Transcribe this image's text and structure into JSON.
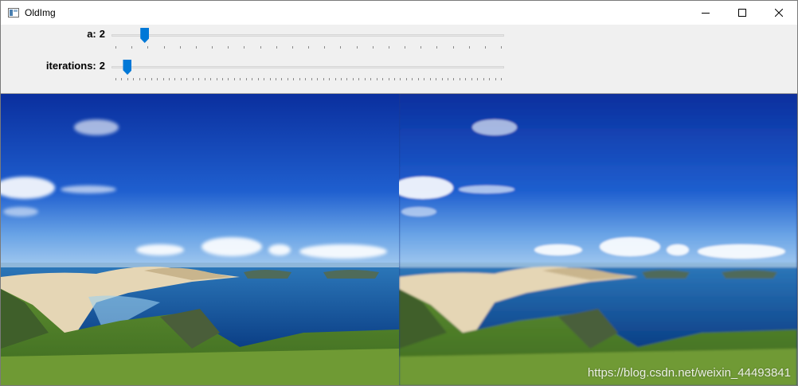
{
  "window": {
    "title": "OldImg",
    "controls": [
      "minimize-icon",
      "maximize-icon",
      "close-icon"
    ]
  },
  "sliders": [
    {
      "label": "a",
      "separator": ":",
      "value": 2,
      "value_text": "2",
      "position_fraction": 0.075,
      "tick_count": 25
    },
    {
      "label": "iterations",
      "separator": ":",
      "value": 2,
      "value_text": "2",
      "position_fraction": 0.03,
      "tick_count": 66
    }
  ],
  "images": [
    {
      "name": "original-photo",
      "description_icon": "landscape-photo"
    },
    {
      "name": "processed-photo",
      "description_icon": "landscape-photo"
    }
  ],
  "watermark": "https://blog.csdn.net/weixin_44493841",
  "colors": {
    "thumb": "#0078d7",
    "sky_top": "#0a2fa0",
    "sea": "#0d4a8f",
    "sand": "#e9dcc0",
    "grass": "#4e7a2a"
  }
}
